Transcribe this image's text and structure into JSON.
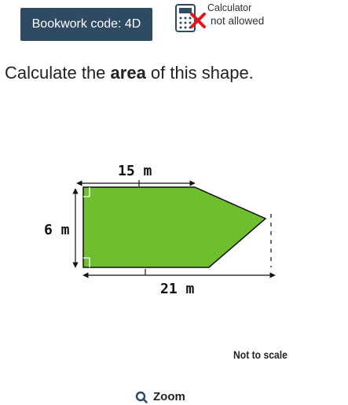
{
  "header": {
    "bookwork_code": "Bookwork code: 4D",
    "calculator_title": "Calculator",
    "calculator_status": "not allowed"
  },
  "question": {
    "prefix": "Calculate the ",
    "emphasis": "area",
    "suffix": " of this shape."
  },
  "figure": {
    "top_length": "15 m",
    "height": "6 m",
    "bottom_length": "21 m",
    "fill_color": "#6fbe2e"
  },
  "note": "Not to scale",
  "zoom_label": "Zoom"
}
